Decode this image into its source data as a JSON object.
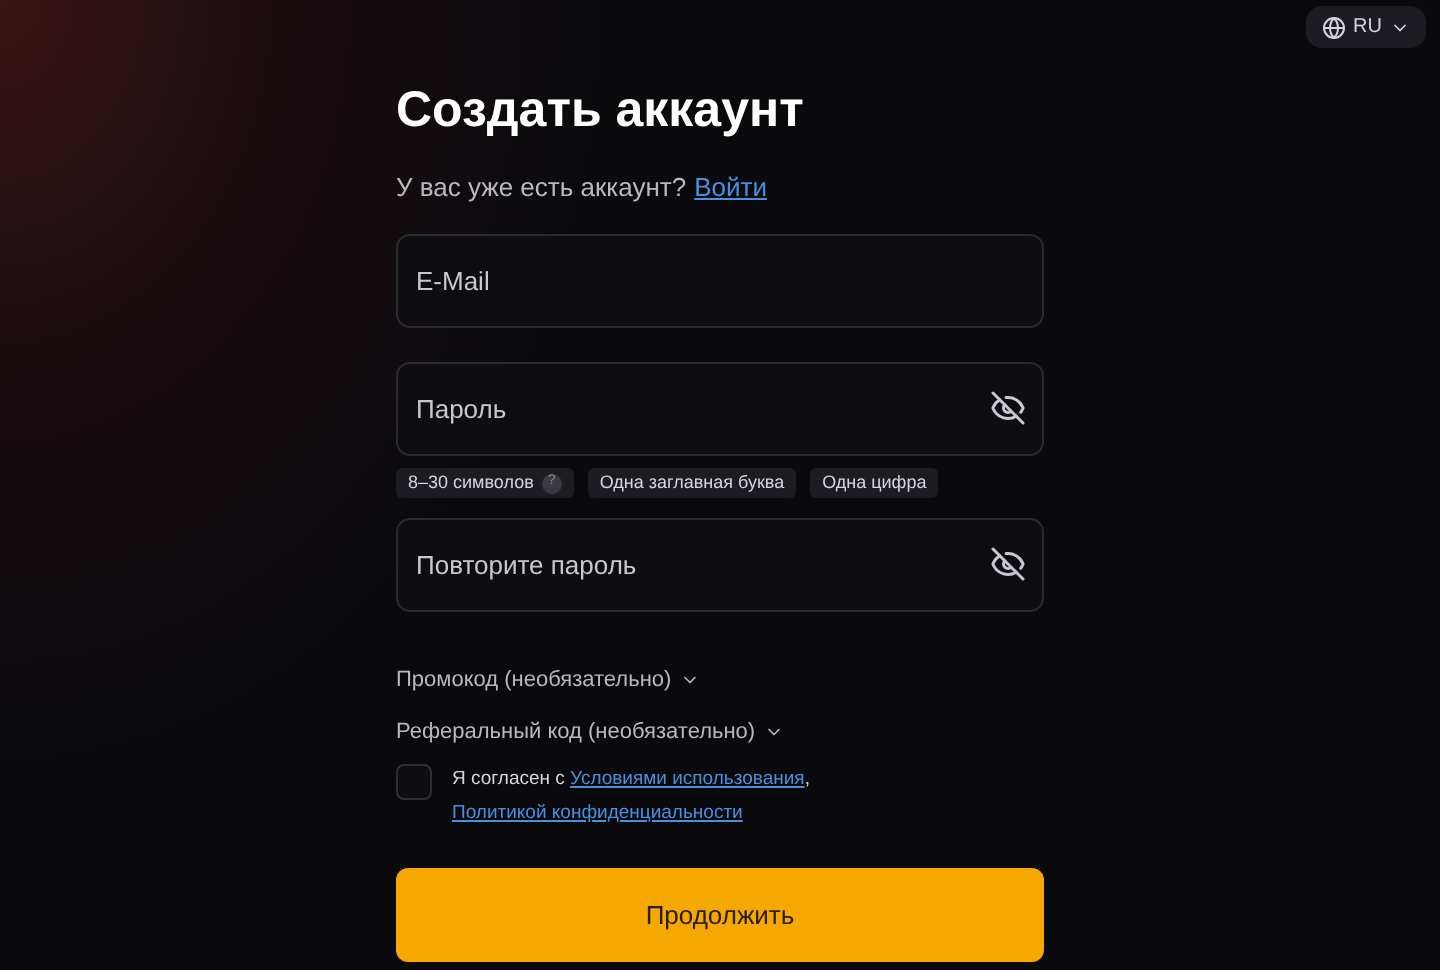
{
  "language": {
    "label": "RU"
  },
  "title": "Создать аккаунт",
  "login_prompt": {
    "text": "У вас уже есть аккаунт?",
    "link": "Войти"
  },
  "fields": [
    {
      "placeholder": "E-Mail",
      "kind": "text"
    },
    {
      "placeholder": "Пароль",
      "kind": "password",
      "hints": [
        {
          "text": "8–30 символов",
          "help": "?"
        },
        {
          "text": "Одна заглавная буква"
        },
        {
          "text": "Одна цифра"
        }
      ]
    },
    {
      "placeholder": "Повторите пароль",
      "kind": "password"
    }
  ],
  "optional": [
    {
      "label": "Промокод (необязательно)",
      "expanded": false
    },
    {
      "label": "Реферальный код (необязательно)",
      "expanded": false
    }
  ],
  "consent": {
    "checked": false,
    "text": "Я согласен с",
    "link1": "Условиями использования",
    "separator": ",",
    "link2": "Политикой конфиденциальности"
  },
  "submit": "Продолжить"
}
